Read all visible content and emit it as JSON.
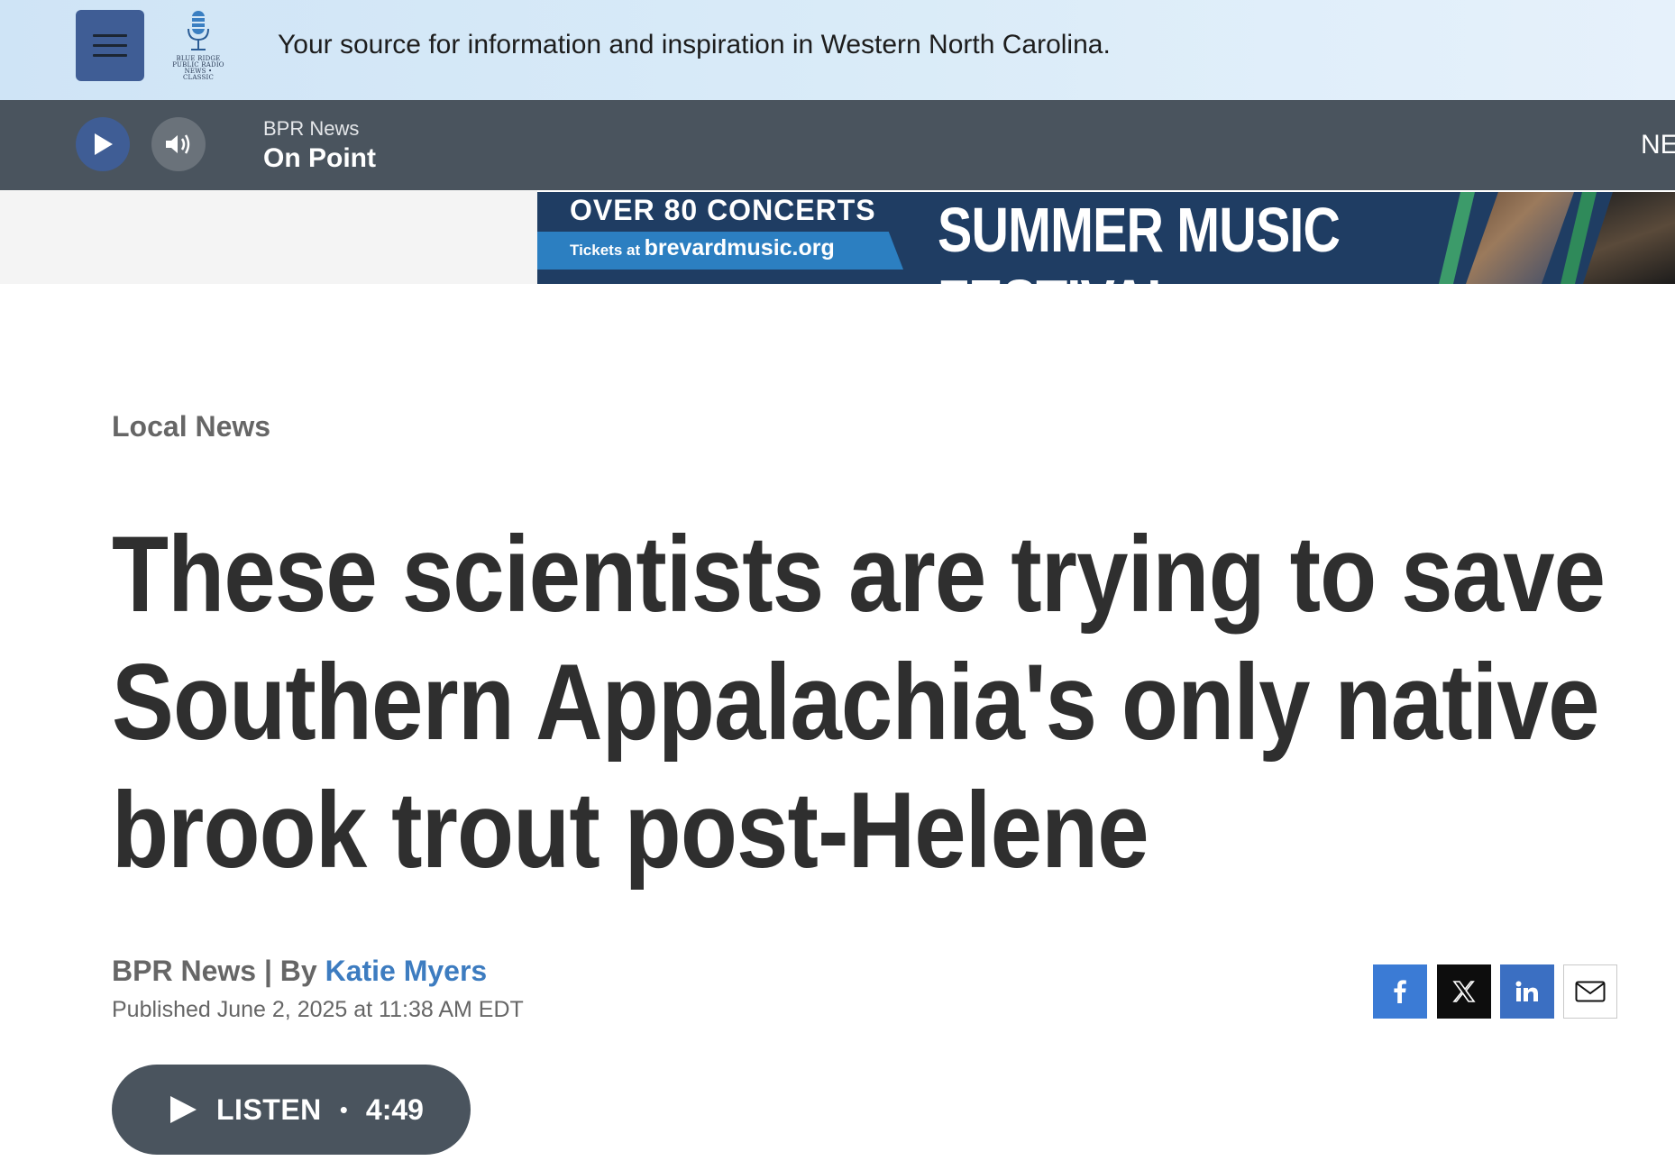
{
  "header": {
    "logo_text": "BLUE RIDGE PUBLIC RADIO NEWS • CLASSIC",
    "tagline": "Your source for information and inspiration in Western North Carolina."
  },
  "player": {
    "station": "BPR News",
    "program": "On Point",
    "right_text": "NE"
  },
  "ad": {
    "headline": "OVER 80 CONCERTS",
    "tickets_prefix": "Tickets at",
    "tickets_site": "brevardmusic.org",
    "title": "SUMMER MUSIC FESTIVAL"
  },
  "article": {
    "category": "Local News",
    "headline_lines": [
      "These scientists are trying to save",
      "Southern Appalachia's only native",
      "brook trout post-Helene"
    ],
    "byline_prefix": "BPR News | By",
    "author": "Katie Myers",
    "published": "Published June 2, 2025 at 11:38 AM EDT"
  },
  "share": {
    "icons": [
      "facebook-icon",
      "x-icon",
      "linkedin-icon",
      "email-icon"
    ]
  },
  "listen": {
    "label": "LISTEN",
    "separator": "•",
    "duration": "4:49"
  },
  "colors": {
    "accent": "#3f5d95",
    "player_bg": "#4a545e",
    "author_link": "#3d7cc0",
    "facebook": "#3b7bd5",
    "linkedin": "#3b6fc2"
  }
}
